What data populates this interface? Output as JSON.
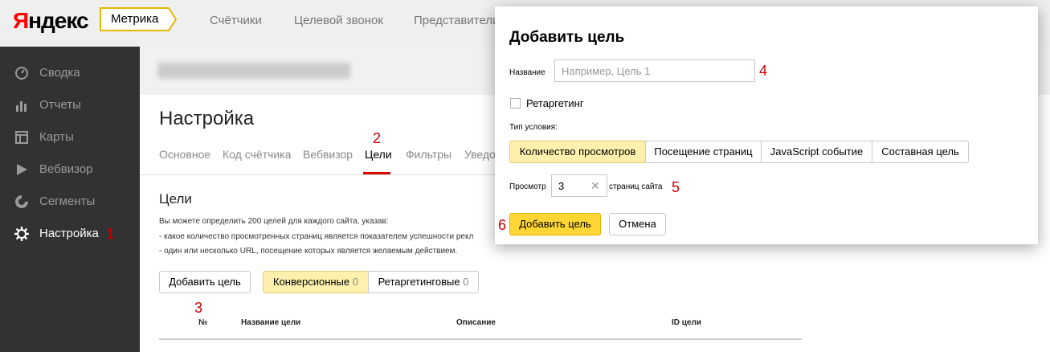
{
  "header": {
    "logo_red": "Я",
    "logo_rest": "ндекс",
    "product": "Метрика",
    "nav": [
      "Счётчики",
      "Целевой звонок",
      "Представители"
    ]
  },
  "sidebar": {
    "items": [
      {
        "label": "Сводка",
        "icon": "gauge-icon"
      },
      {
        "label": "Отчеты",
        "icon": "bar-chart-icon"
      },
      {
        "label": "Карты",
        "icon": "map-icon"
      },
      {
        "label": "Вебвизор",
        "icon": "play-icon"
      },
      {
        "label": "Сегменты",
        "icon": "pie-icon"
      },
      {
        "label": "Настройка",
        "icon": "gear-icon"
      }
    ]
  },
  "main": {
    "title": "Настройка",
    "tabs": [
      "Основное",
      "Код счётчика",
      "Вебвизор",
      "Цели",
      "Фильтры",
      "Уведо"
    ],
    "section_title": "Цели",
    "desc": [
      "Вы можете определить 200 целей для каждого сайта, указав:",
      "-  какое количество просмотренных страниц является показателем успешности рекл",
      "-  один или несколько URL, посещение которых является желаемым действием."
    ],
    "add_goal_label": "Добавить цель",
    "seg_conversion": "Конверсионные",
    "seg_conversion_count": "0",
    "seg_retarget": "Ретаргетинговые",
    "seg_retarget_count": "0",
    "columns": [
      "№",
      "Название цели",
      "Описание",
      "ID цели"
    ]
  },
  "modal": {
    "title": "Добавить цель",
    "name_label": "Название",
    "name_placeholder": "Например, Цель 1",
    "retarget_label": "Ретаргетинг",
    "cond_label": "Тип условия:",
    "conditions": [
      "Количество просмотров",
      "Посещение страниц",
      "JavaScript событие",
      "Составная цель"
    ],
    "views_label": "Просмотр",
    "views_value": "3",
    "views_suffix": "страниц сайта",
    "clear": "✕",
    "submit_label": "Добавить цель",
    "cancel_label": "Отмена"
  },
  "marks": [
    "1",
    "2",
    "3",
    "4",
    "5",
    "6"
  ],
  "colors": {
    "accent_yellow": "#ffd633",
    "selected_yellow": "#fff1ad",
    "mark_red": "#c00",
    "sidebar_bg": "#323232"
  }
}
